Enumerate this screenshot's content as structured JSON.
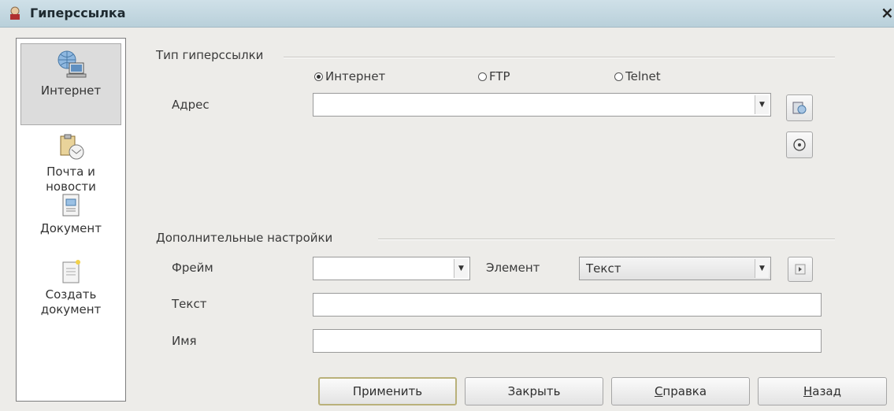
{
  "window": {
    "title": "Гиперссылка",
    "close": "×"
  },
  "sidebar": {
    "items": [
      {
        "label": "Интернет",
        "icon": "globe-computer-icon",
        "active": true
      },
      {
        "label": "Почта и\nновости",
        "icon": "mail-clipboard-icon"
      },
      {
        "label": "Документ",
        "icon": "document-icon"
      },
      {
        "label": "Создать\nдокумент",
        "icon": "new-document-icon"
      }
    ]
  },
  "hyperlink_type": {
    "title": "Тип гиперссылки",
    "options": [
      {
        "label": "Интернет",
        "selected": true
      },
      {
        "label": "FTP",
        "selected": false
      },
      {
        "label": "Telnet",
        "selected": false
      }
    ],
    "address_label": "Адрес",
    "address_value": ""
  },
  "additional": {
    "title": "Дополнительные настройки",
    "frame_label": "Фрейм",
    "frame_value": "",
    "element_label": "Элемент",
    "element_value": "Текст",
    "text_label": "Текст",
    "text_value": "",
    "name_label": "Имя",
    "name_value": ""
  },
  "buttons": {
    "apply": "Применить",
    "close": "Закрыть",
    "help_mnemonic": "С",
    "help_rest": "правка",
    "back_mnemonic": "Н",
    "back_rest": "азад"
  },
  "colors": {
    "titlebar": "#c4d8e1",
    "dialog_bg": "#edece9"
  }
}
